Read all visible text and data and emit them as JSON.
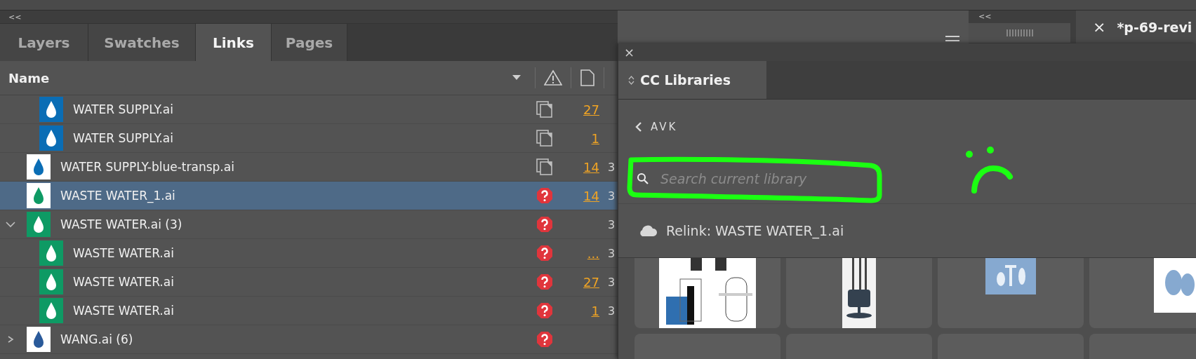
{
  "collapse_label": "<<",
  "tabs": [
    {
      "label": "Layers",
      "selected": false
    },
    {
      "label": "Swatches",
      "selected": false
    },
    {
      "label": "Links",
      "selected": true
    },
    {
      "label": "Pages",
      "selected": false
    }
  ],
  "links": {
    "header": "Name",
    "rows": [
      {
        "children": [
          {
            "name": "WATER SUPPLY.ai",
            "color": "#0a6db5",
            "inverted": false,
            "kind": "placed",
            "page": "27",
            "selected": false
          },
          {
            "name": "WATER SUPPLY.ai",
            "color": "#0a6db5",
            "inverted": false,
            "kind": "placed",
            "page": "1",
            "selected": false
          }
        ]
      },
      {
        "name": "WATER SUPPLY-blue-transp.ai",
        "color": "#0a6db5",
        "inverted": true,
        "kind": "placed",
        "page": "14",
        "column_3": "3",
        "selected": false
      },
      {
        "name": "WASTE WATER_1.ai",
        "color": "#0e9a64",
        "inverted": true,
        "kind": "missing",
        "page": "14",
        "column_3": "3",
        "selected": true
      },
      {
        "name": "WASTE WATER.ai (3)",
        "color": "#0e9a64",
        "inverted": false,
        "kind": "missing",
        "column_3": "3",
        "selected": false,
        "expanded": true,
        "children": [
          {
            "name": "WASTE WATER.ai",
            "color": "#0e9a64",
            "inverted": false,
            "kind": "missing",
            "page": "...",
            "column_3": "3",
            "selected": false
          },
          {
            "name": "WASTE WATER.ai",
            "color": "#0e9a64",
            "inverted": false,
            "kind": "missing",
            "page": "27",
            "column_3": "3",
            "selected": false
          },
          {
            "name": "WASTE WATER.ai",
            "color": "#0e9a64",
            "inverted": false,
            "kind": "missing",
            "page": "1",
            "column_3": "3",
            "selected": false
          }
        ]
      },
      {
        "name": "WANG.ai (6)",
        "color": "#2a5a9a",
        "inverted": true,
        "kind": "missing",
        "selected": false,
        "expanded": false
      }
    ]
  },
  "document_tab": {
    "title": "*p-69-revi",
    "close": "×"
  },
  "libraries": {
    "close": "×",
    "tab": "CC Libraries",
    "back": "AVK",
    "search": {
      "placeholder": "Search current library"
    },
    "relink": "Relink: WASTE WATER_1.ai",
    "assets": [
      {
        "kind": "picture"
      },
      {
        "kind": "picture"
      },
      {
        "kind": "picture"
      },
      {
        "kind": "picture"
      },
      {
        "kind": "empty"
      },
      {
        "kind": "empty"
      },
      {
        "kind": "empty"
      },
      {
        "kind": "empty"
      }
    ]
  }
}
